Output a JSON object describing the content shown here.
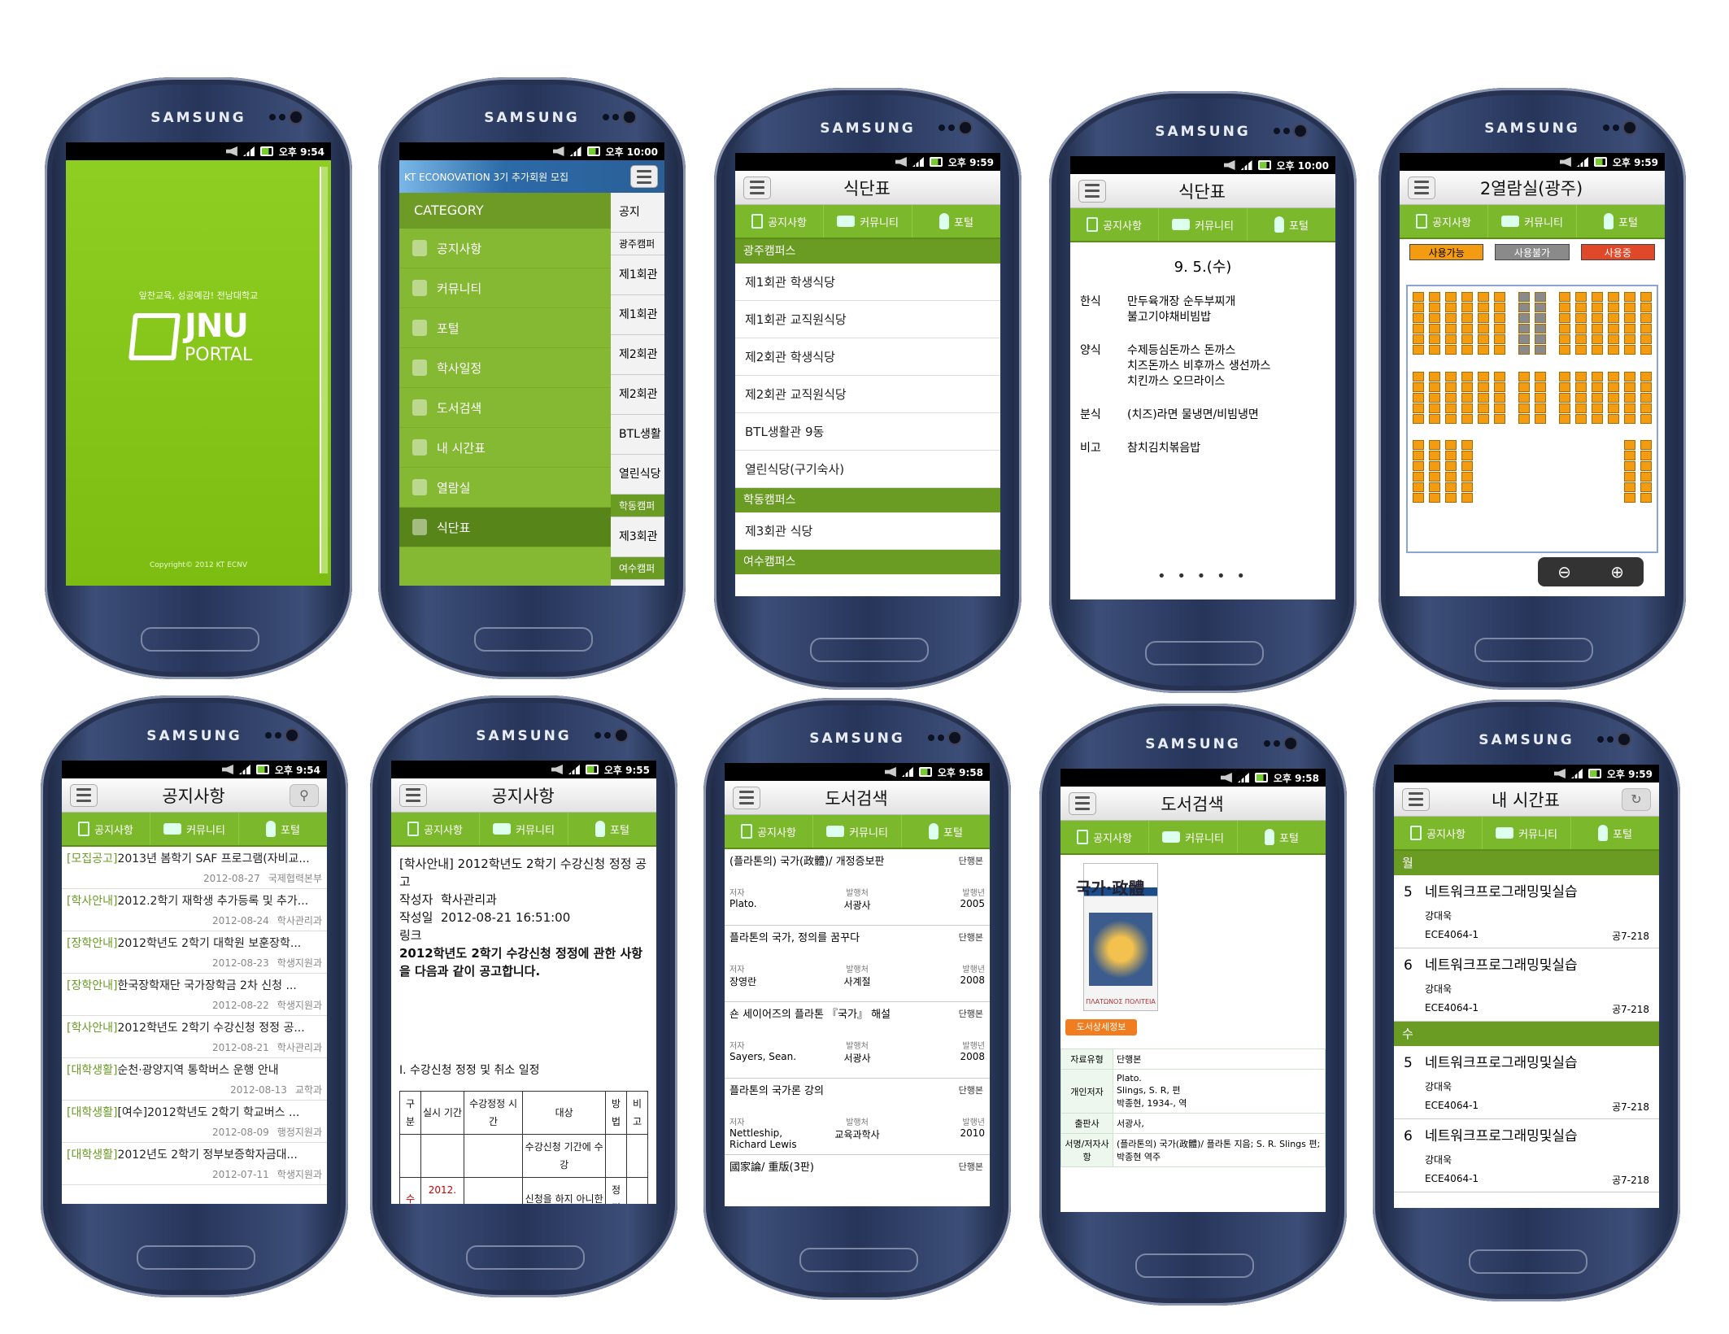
{
  "phone_brand": "SAMSUNG",
  "common": {
    "tabs": [
      "공지사항",
      "커뮤니티",
      "포털"
    ]
  },
  "s1": {
    "time": "오후 9:54",
    "slogan": "앞찬교육, 성공예감! 전남대학교",
    "logo_main": "JNU",
    "logo_sub": "PORTAL",
    "copyright": "Copyright© 2012  KT ECNV",
    "accent": "#7dbd12"
  },
  "s2": {
    "time": "오후 10:00",
    "banner": "KT ECONOVATION 3기 추가회원 모집",
    "category_title": "CATEGORY",
    "items": [
      "공지사항",
      "커뮤니티",
      "포털",
      "학사일정",
      "도서검색",
      "내 시간표",
      "열람실",
      "식단표"
    ],
    "peek": [
      "공지",
      "광주캠퍼",
      "제1회관",
      "제1회관",
      "제2회관",
      "제2회관",
      "BTL생활",
      "열린식당",
      "학동캠퍼",
      "제3회관",
      "여수캠퍼"
    ]
  },
  "s3": {
    "time": "오후 9:59",
    "title": "식단표",
    "sections": [
      {
        "name": "광주캠퍼스",
        "rows": [
          "제1회관 학생식당",
          "제1회관 교직원식당",
          "제2회관 학생식당",
          "제2회관 교직원식당",
          "BTL생활관 9동",
          "열린식당(구기숙사)"
        ]
      },
      {
        "name": "학동캠퍼스",
        "rows": [
          "제3회관 식당"
        ]
      },
      {
        "name": "여수캠퍼스",
        "rows": []
      }
    ]
  },
  "s4": {
    "time": "오후 10:00",
    "title": "식단표",
    "date": "9. 5.(수)",
    "menus": [
      {
        "k": "한식",
        "v": "만두육개장 순두부찌개\n불고기야채비빔밥"
      },
      {
        "k": "양식",
        "v": "수제등심돈까스 돈까스\n치즈돈까스 비후까스 생선까스\n치킨까스 오므라이스"
      },
      {
        "k": "분식",
        "v": "(치즈)라면 물냉면/비빔냉면"
      },
      {
        "k": "비고",
        "v": "참치김치볶음밥"
      }
    ],
    "pager": "• • • • •"
  },
  "s5": {
    "time": "오후 9:59",
    "title": "2열람실(광주)",
    "legend": [
      {
        "label": "사용가능",
        "color": "#f39c12"
      },
      {
        "label": "사용불가",
        "color": "#8a8a8a"
      },
      {
        "label": "사용중",
        "color": "#e0482a"
      }
    ]
  },
  "s6": {
    "time": "오후 9:54",
    "title": "공지사항",
    "notices": [
      {
        "tag": "[모집공고]",
        "title": "2013년 봄학기 SAF 프로그램(자비교...",
        "date": "2012-08-27",
        "dept": "국제협력본부"
      },
      {
        "tag": "[학사안내]",
        "title": "2012.2학기 재학생 추가등록 및 추가...",
        "date": "2012-08-24",
        "dept": "학사관리과"
      },
      {
        "tag": "[장학안내]",
        "title": "2012학년도 2학기 대학원 보훈장학...",
        "date": "2012-08-23",
        "dept": "학생지원과"
      },
      {
        "tag": "[장학안내]",
        "title": "한국장학재단 국가장학금 2차 신청 ...",
        "date": "2012-08-22",
        "dept": "학생지원과"
      },
      {
        "tag": "[학사안내]",
        "title": "2012학년도 2학기 수강신청 정정 공...",
        "date": "2012-08-21",
        "dept": "학사관리과"
      },
      {
        "tag": "[대학생활]",
        "title": "순천·광양지역 통학버스 운행 안내",
        "date": "2012-08-13",
        "dept": "교학과"
      },
      {
        "tag": "[대학생활]",
        "title": "[여수]2012학년도 2학기 학교버스 ...",
        "date": "2012-08-09",
        "dept": "행정지원과"
      },
      {
        "tag": "[대학생활]",
        "title": "2012년도 2학기 정부보증학자금대...",
        "date": "2012-07-11",
        "dept": "학생지원과"
      }
    ]
  },
  "s7": {
    "time": "오후 9:55",
    "title": "공지사항",
    "heading": "[학사안내] 2012학년도 2학기 수강신청 정정 공고",
    "author_label": "작성자",
    "author": "학사관리과",
    "date_label": "작성일",
    "date": "2012-08-21 16:51:00",
    "link_label": "링크",
    "body": "2012학년도 2학기 수강신청 정정에 관한 사항을 다음과 같이 공고합니다.",
    "section": "Ⅰ. 수강신청 정정 및 취소 일정",
    "table_head": [
      "구분",
      "실시 기간",
      "수강정정 시 간",
      "대상",
      "방법",
      "비고"
    ],
    "table_row": [
      "",
      "",
      "",
      "수강신청 기간에 수강",
      "",
      ""
    ],
    "table_row2": [
      "수",
      "2012. 8.",
      "",
      "신청을 하지 아니한",
      "정정",
      ""
    ]
  },
  "s8": {
    "time": "오후 9:58",
    "title": "도서검색",
    "labels": {
      "author": "저자",
      "publisher": "발행처",
      "year": "발행년"
    },
    "books": [
      {
        "title": "(플라톤의) 국가(政體)/ 개정증보판",
        "kind": "단행본",
        "author": "Plato.",
        "publisher": "서광사",
        "year": "2005"
      },
      {
        "title": "플라톤의 국가, 정의를 꿈꾸다",
        "kind": "단행본",
        "author": "장영란",
        "publisher": "사계절",
        "year": "2008"
      },
      {
        "title": "숀 세이어즈의 플라톤 『국가』 해설",
        "kind": "단행본",
        "author": "Sayers, Sean.",
        "publisher": "서광사",
        "year": "2008"
      },
      {
        "title": "플라톤의 국가론 강의",
        "kind": "단행본",
        "author": "Nettleship, Richard Lewis",
        "publisher": "교육과학사",
        "year": "2010"
      },
      {
        "title": "國家論/ 重版(3판)",
        "kind": "단행본",
        "author": "",
        "publisher": "",
        "year": ""
      }
    ]
  },
  "s9": {
    "time": "오후 9:58",
    "title": "도서검색",
    "cover_title": "국가·政體",
    "cover_sub": "ΠΛΑΤΩΝΟΣ ΠΟΛΙΤΕΙΑ",
    "detail_button": "도서상세정보",
    "fields": [
      {
        "k": "자료유형",
        "v": "단행본"
      },
      {
        "k": "개인저자",
        "v": "Plato.\nSlings, S. R, 편\n박종현, 1934-, 역"
      },
      {
        "k": "출판사",
        "v": "서광사,"
      },
      {
        "k": "서명/저자사항",
        "v": "(플라톤의) 국가(政體)/ 플라톤 지음; S. R. Slings 편; 박종현 역주"
      }
    ]
  },
  "s10": {
    "time": "오후 9:59",
    "title": "내 시간표",
    "days": [
      {
        "day": "월",
        "classes": [
          {
            "period": "5",
            "name": "네트워크프로그래밍및실습",
            "prof": "강대욱",
            "code": "ECE4064-1",
            "room": "공7-218"
          },
          {
            "period": "6",
            "name": "네트워크프로그래밍및실습",
            "prof": "강대욱",
            "code": "ECE4064-1",
            "room": "공7-218"
          }
        ]
      },
      {
        "day": "수",
        "classes": [
          {
            "period": "5",
            "name": "네트워크프로그래밍및실습",
            "prof": "강대욱",
            "code": "ECE4064-1",
            "room": "공7-218"
          },
          {
            "period": "6",
            "name": "네트워크프로그래밍및실습",
            "prof": "강대욱",
            "code": "ECE4064-1",
            "room": "공7-218"
          }
        ]
      }
    ]
  }
}
